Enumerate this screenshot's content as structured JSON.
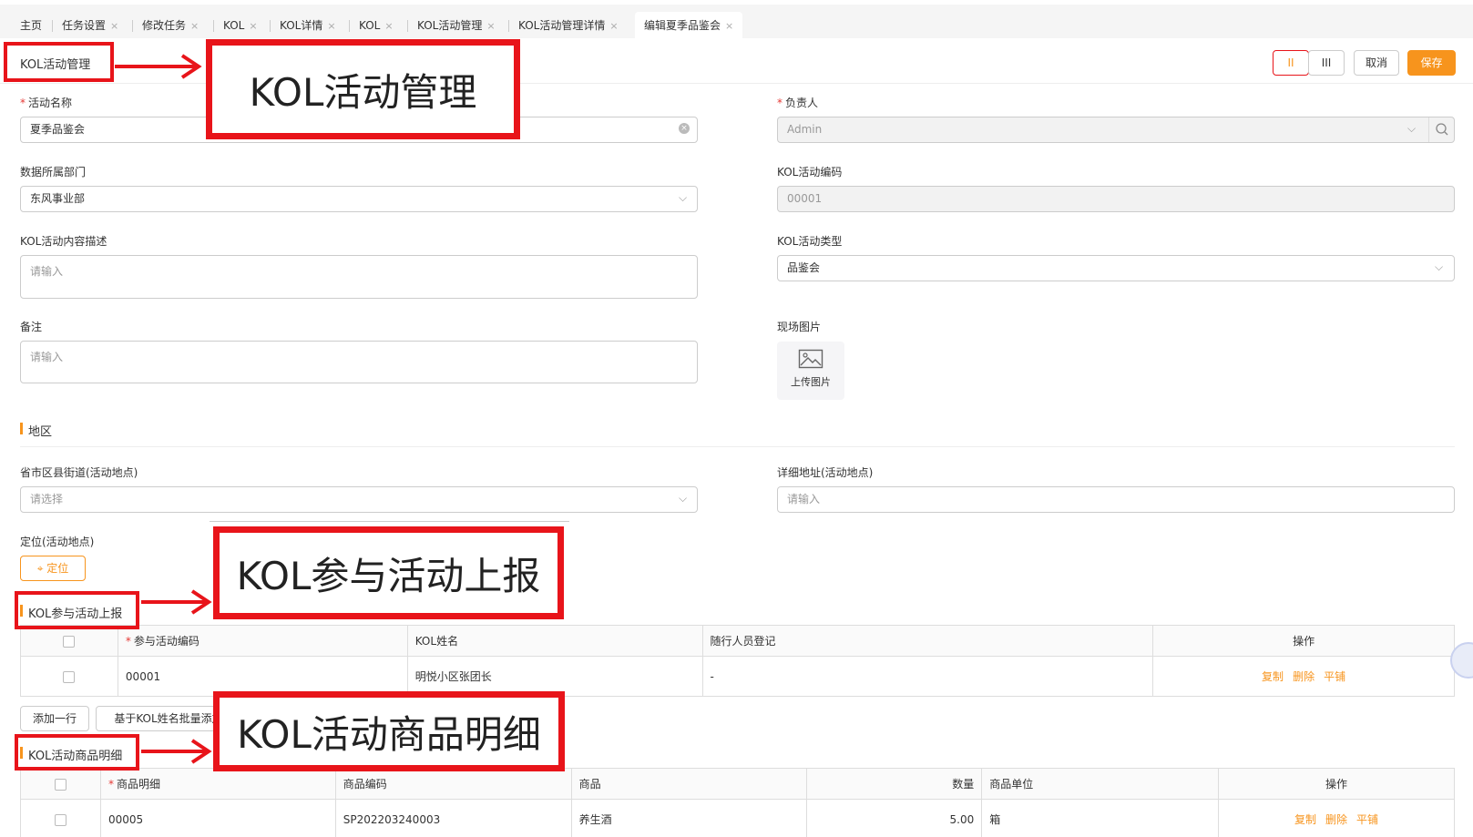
{
  "tabs": [
    {
      "label": "主页",
      "closable": false
    },
    {
      "label": "任务设置",
      "closable": true
    },
    {
      "label": "修改任务",
      "closable": true
    },
    {
      "label": "KOL",
      "closable": true
    },
    {
      "label": "KOL详情",
      "closable": true
    },
    {
      "label": "KOL",
      "closable": true
    },
    {
      "label": "KOL活动管理",
      "closable": true
    },
    {
      "label": "KOL活动管理详情",
      "closable": true
    },
    {
      "label": "编辑夏季品鉴会",
      "closable": true,
      "active": true
    }
  ],
  "close_glyph": "×",
  "header": {
    "title": "KOL活动管理",
    "layout_two_col": "II",
    "layout_three_col": "III",
    "cancel": "取消",
    "save": "保存"
  },
  "form": {
    "activity_name": {
      "label": "活动名称",
      "value": "夏季品鉴会"
    },
    "owner": {
      "label": "负责人",
      "value": "Admin"
    },
    "department": {
      "label": "数据所属部门",
      "value": "东风事业部"
    },
    "activity_code": {
      "label": "KOL活动编码",
      "value": "00001"
    },
    "description": {
      "label": "KOL活动内容描述",
      "placeholder": "请输入"
    },
    "activity_type": {
      "label": "KOL活动类型",
      "value": "品鉴会"
    },
    "remark": {
      "label": "备注",
      "placeholder": "请输入"
    },
    "site_photo": {
      "label": "现场图片",
      "upload": "上传图片"
    }
  },
  "region": {
    "title": "地区",
    "area": {
      "label": "省市区县街道(活动地点)",
      "placeholder": "请选择"
    },
    "address": {
      "label": "详细地址(活动地点)",
      "placeholder": "请输入"
    },
    "location": {
      "label": "定位(活动地点)",
      "button": "定位"
    }
  },
  "kol_report": {
    "title": "KOL参与活动上报",
    "columns": [
      "参与活动编码",
      "KOL姓名",
      "随行人员登记",
      "操作"
    ],
    "rows": [
      {
        "code": "00001",
        "name": "明悦小区张团长",
        "companions": "-"
      }
    ],
    "actions": [
      "复制",
      "删除",
      "平铺"
    ],
    "add_row": "添加一行",
    "batch_add": "基于KOL姓名批量添加"
  },
  "product_detail": {
    "title": "KOL活动商品明细",
    "columns": [
      "商品明细",
      "商品编码",
      "商品",
      "数量",
      "商品单位",
      "操作"
    ],
    "rows": [
      {
        "detail": "00005",
        "code": "SP202203240003",
        "product": "养生酒",
        "qty": "5.00",
        "unit": "箱"
      }
    ],
    "actions": [
      "复制",
      "删除",
      "平铺"
    ]
  },
  "annotations": {
    "callout_1": "KOL活动管理",
    "callout_2": "KOL参与活动上报",
    "callout_3": "KOL活动商品明细"
  },
  "colors": {
    "accent": "#f7941d",
    "required": "#e53935",
    "annotation_red": "#e8141a"
  }
}
